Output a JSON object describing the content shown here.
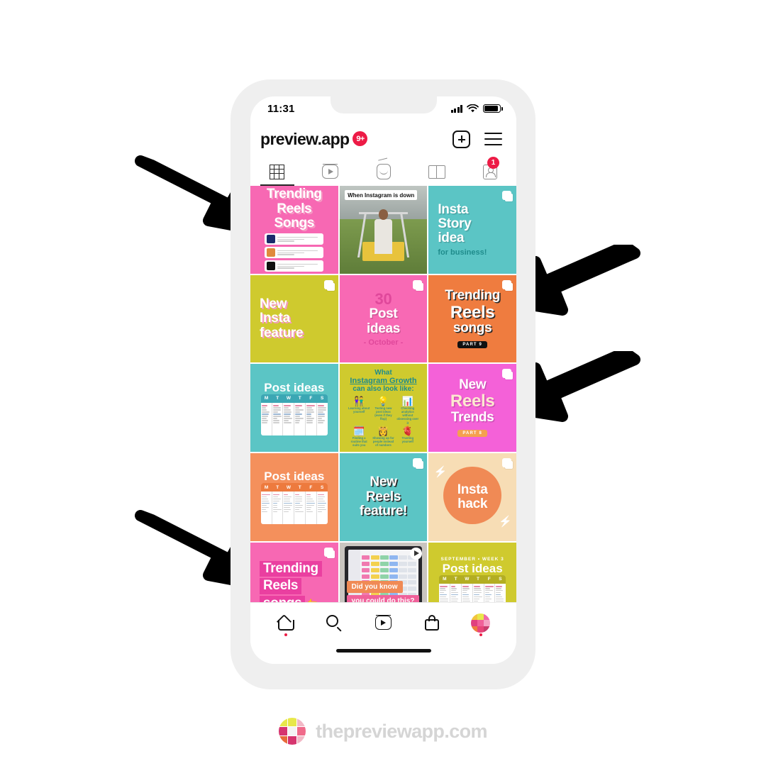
{
  "statusbar": {
    "time": "11:31",
    "signal_icon": "cellular-bars-icon",
    "wifi_icon": "wifi-icon",
    "battery_icon": "battery-icon"
  },
  "appbar": {
    "brand": "preview.app",
    "badge": "9+",
    "add_icon": "plus-square-icon",
    "menu_icon": "hamburger-menu-icon"
  },
  "tabs": [
    {
      "name": "tab-grid",
      "icon": "grid-icon",
      "active": true,
      "badge": ""
    },
    {
      "name": "tab-reels",
      "icon": "reels-icon",
      "active": false,
      "badge": ""
    },
    {
      "name": "tab-igtv",
      "icon": "igtv-icon",
      "active": false,
      "badge": ""
    },
    {
      "name": "tab-guides",
      "icon": "guides-icon",
      "active": false,
      "badge": ""
    },
    {
      "name": "tab-tagged",
      "icon": "tagged-icon",
      "active": false,
      "badge": "1"
    }
  ],
  "grid": [
    {
      "id": "trending-reels-songs-1",
      "kind": "text",
      "bg": "#f768b3",
      "line1": "Trending",
      "line2": "Reels Songs",
      "align": "center",
      "text_color": "#ffffff",
      "style": "shadow-pink",
      "has_song_list": true,
      "carousel": false,
      "badge": ""
    },
    {
      "id": "when-instagram-is-down",
      "kind": "photo-swing",
      "bg": "#8a9490",
      "caption": "When Instagram is down",
      "carousel": false,
      "badge": ""
    },
    {
      "id": "insta-story-idea",
      "kind": "text",
      "bg": "#5bc5c5",
      "line1": "Insta",
      "line2": "Story",
      "line3": "idea",
      "sub": "for business!",
      "align": "left",
      "text_color": "#ffffff",
      "sub_color": "#1f8c8c",
      "carousel": true,
      "badge": ""
    },
    {
      "id": "new-insta-feature",
      "kind": "text",
      "bg": "#cfca2e",
      "line1": "New",
      "line2": "Insta",
      "line3": "feature",
      "align": "left",
      "text_color": "#ffffff",
      "style": "shadow-pink",
      "carousel": true,
      "badge": ""
    },
    {
      "id": "30-post-ideas",
      "kind": "text",
      "bg": "#f869b4",
      "line1": "30",
      "line2": "Post",
      "line3": "ideas",
      "sub": "- October -",
      "align": "center",
      "text_color": "#ffffff",
      "sub_color": "#e0489b",
      "carousel": true,
      "badge": ""
    },
    {
      "id": "trending-reels-songs-part9",
      "kind": "text",
      "bg": "#ef7c3f",
      "line1": "Trending",
      "line2": "Reels",
      "line3": "songs",
      "align": "center",
      "text_color": "#ffffff",
      "style": "shadow-dark",
      "carousel": true,
      "badge": "PART 9",
      "badge_bg": "#111111",
      "badge_color": "#ffffff"
    },
    {
      "id": "post-ideas-teal",
      "kind": "planner",
      "bg": "#5bc5c5",
      "line1": "Post ideas",
      "header_bg": "#3ba7b4",
      "align": "center",
      "text_color": "#ffffff",
      "carousel": false,
      "badge": ""
    },
    {
      "id": "instagram-growth",
      "kind": "growth",
      "bg": "#cfca2e",
      "line1": "What",
      "line2": "Instagram Growth",
      "line3": "can also look like:",
      "text_color": "#1f8c8c",
      "carousel": false,
      "badge": "",
      "items": [
        {
          "emoji": "👫",
          "caption": "Learning about yourself"
        },
        {
          "emoji": "💡",
          "caption": "Testing new post ideas (even if they flop)"
        },
        {
          "emoji": "📊",
          "caption": "Checking analytics without obsessing over it"
        },
        {
          "emoji": "🗓️",
          "caption": "Finding a routine that suits you"
        },
        {
          "emoji": "👸",
          "caption": "Showing up for people instead of numbers"
        },
        {
          "emoji": "🫀",
          "caption": "Trusting yourself"
        }
      ]
    },
    {
      "id": "new-reels-trends-part8",
      "kind": "text",
      "bg": "#f461d8",
      "line1": "New",
      "line2": "Reels",
      "line3": "Trends",
      "align": "center",
      "text_color": "#ffffff",
      "line2_color": "#fde8d0",
      "carousel": true,
      "badge": "PART 8",
      "badge_bg": "#f5a04f",
      "badge_color": "#ffffff"
    },
    {
      "id": "post-ideas-orange",
      "kind": "planner",
      "bg": "#f4905c",
      "line1": "Post ideas",
      "header_bg": "#ed7a3e",
      "align": "center",
      "text_color": "#ffffff",
      "carousel": false,
      "badge": ""
    },
    {
      "id": "new-reels-feature",
      "kind": "text",
      "bg": "#5bc5c5",
      "line1": "New",
      "line2": "Reels",
      "line3": "feature!",
      "align": "center",
      "text_color": "#ffffff",
      "style": "shadow-dark",
      "carousel": true,
      "badge": ""
    },
    {
      "id": "insta-hack",
      "kind": "hack",
      "bg": "#f7ddb5",
      "circle": "#f08a55",
      "line1": "Insta",
      "line2": "hack",
      "text_color": "#ffffff",
      "carousel": true,
      "badge": ""
    },
    {
      "id": "trending-reels-songs-2",
      "kind": "text",
      "bg": "#f768b3",
      "line1": "Trending",
      "line2": "Reels",
      "line3": "songs",
      "emoji": "👉",
      "align": "left",
      "text_color": "#ffffff",
      "highlight_bg": "#ea3fa0",
      "carousel": true,
      "badge": ""
    },
    {
      "id": "did-you-know-video",
      "kind": "photo-laptop",
      "bg": "#c9c5c0",
      "tape1": "Did you know",
      "tape1_bg": "#f08a55",
      "tape2": "you could do this?",
      "tape2_bg": "#f0619a",
      "carousel": false,
      "play": true,
      "badge": ""
    },
    {
      "id": "post-ideas-olive",
      "kind": "planner",
      "bg": "#cfca2e",
      "eyebrow": "SEPTEMBER • WEEK 3",
      "line1": "Post ideas",
      "header_bg": "#b3ae22",
      "align": "center",
      "text_color": "#ffffff",
      "carousel": false,
      "badge": ""
    }
  ],
  "planner_days": [
    "M",
    "T",
    "W",
    "T",
    "F",
    "S"
  ],
  "bottomnav": [
    {
      "name": "nav-home",
      "icon": "home-icon",
      "dot": true
    },
    {
      "name": "nav-search",
      "icon": "search-icon",
      "dot": false
    },
    {
      "name": "nav-reels",
      "icon": "reels-icon",
      "dot": false
    },
    {
      "name": "nav-shop",
      "icon": "shop-bag-icon",
      "dot": false
    },
    {
      "name": "nav-profile",
      "icon": "avatar-icon",
      "dot": true
    }
  ],
  "arrows": [
    {
      "name": "annotation-arrow-top-left",
      "direction": "down-right"
    },
    {
      "name": "annotation-arrow-right-upper",
      "direction": "down-left"
    },
    {
      "name": "annotation-arrow-right-lower",
      "direction": "down-left"
    },
    {
      "name": "annotation-arrow-bottom-left",
      "direction": "down-right"
    }
  ],
  "footer": {
    "text": "thepreviewapp.com",
    "logo_icon": "preview-app-logo-icon"
  },
  "colors": {
    "accent_red": "#ed1b46",
    "pink": "#f768b3",
    "teal": "#5bc5c5",
    "olive": "#cfca2e",
    "orange": "#ef7c3f",
    "magenta": "#f461d8",
    "peach": "#f7ddb5",
    "footer_gray": "#d5d5d5"
  }
}
